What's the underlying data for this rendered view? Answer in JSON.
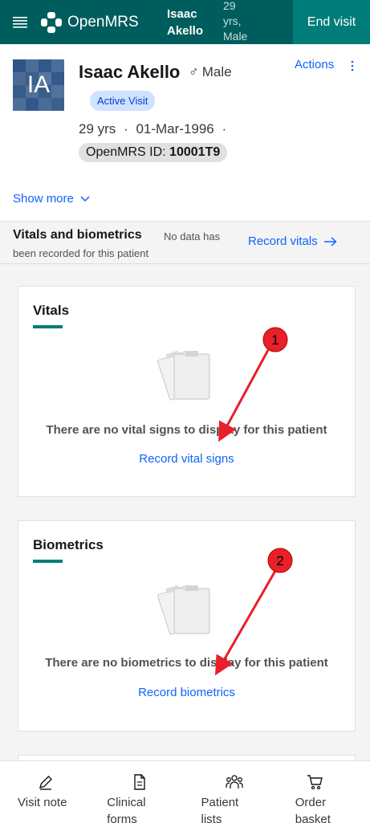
{
  "header": {
    "logo_text": "OpenMRS",
    "patient_name_line1": "Isaac",
    "patient_name_line2": "Akello",
    "patient_age_line1": "29",
    "patient_age_line2": "yrs,",
    "patient_age_line3": "Male",
    "end_visit_label": "End visit",
    "colors": {
      "bar": "#005d5d",
      "end_visit": "#007d79"
    }
  },
  "banner": {
    "avatar_initials": "IA",
    "name": "Isaac Akello",
    "gender_symbol": "♂",
    "gender": "Male",
    "visit_tag": "Active Visit",
    "age": "29 yrs",
    "birthdate": "01-Mar-1996",
    "separator": "·",
    "id_label": "OpenMRS ID:",
    "id_value": "10001T9",
    "actions_label": "Actions",
    "show_more_label": "Show more"
  },
  "vitals_section": {
    "title": "Vitals and biometrics",
    "empty_line1": "No data has",
    "empty_line2": "been recorded for this patient",
    "record_link": "Record vitals",
    "arrow_icon": "arrow-right-icon"
  },
  "cards": [
    {
      "title": "Vitals",
      "empty_text": "There are no vital signs to display for this patient",
      "link": "Record vital signs",
      "annotation_number": "1"
    },
    {
      "title": "Biometrics",
      "empty_text": "There are no biometrics to display for this patient",
      "link": "Record biometrics",
      "annotation_number": "2"
    }
  ],
  "bottom_nav": [
    {
      "line1": "Visit note",
      "line2": "",
      "icon": "pen-icon"
    },
    {
      "line1": "Clinical",
      "line2": "forms",
      "icon": "document-icon"
    },
    {
      "line1": "Patient",
      "line2": "lists",
      "icon": "people-icon"
    },
    {
      "line1": "Order",
      "line2": "basket",
      "icon": "cart-icon"
    }
  ],
  "colors": {
    "accent": "#0f62fe",
    "teal": "#007d79",
    "annotation_red": "#e8202a"
  }
}
